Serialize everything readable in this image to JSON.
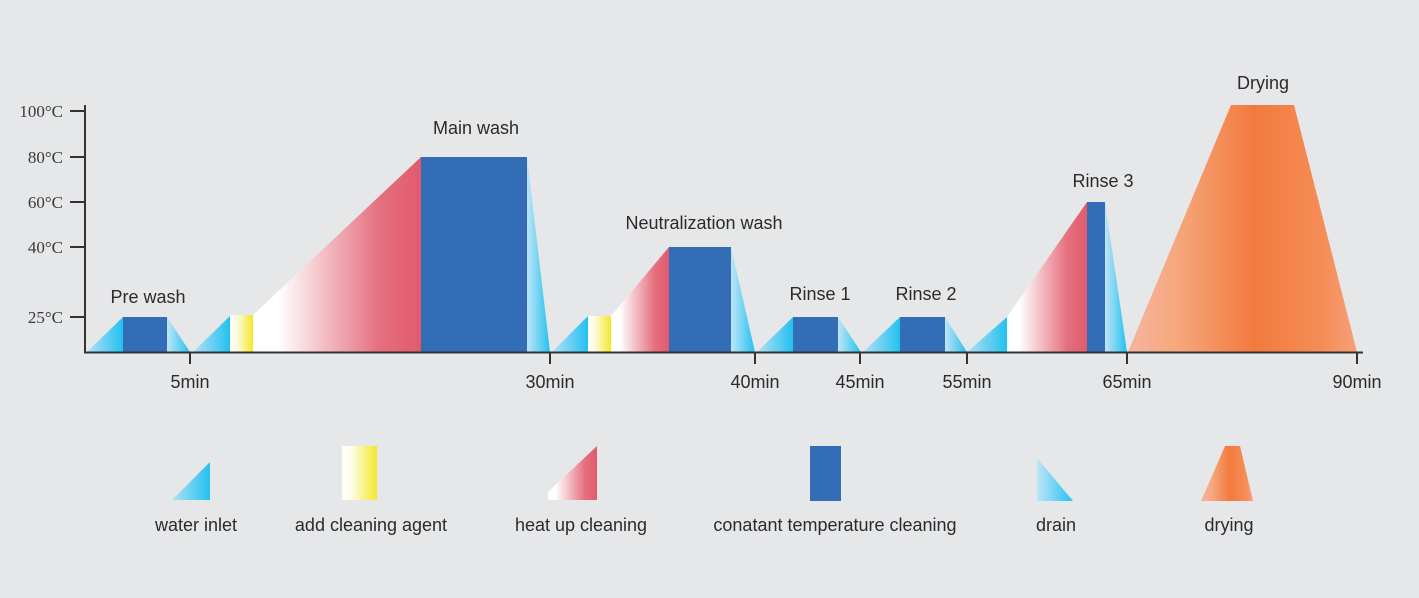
{
  "chart_data": {
    "type": "process-timeline",
    "y_axis": {
      "ticks": [
        "100°C",
        "80°C",
        "60°C",
        "40°C",
        "25°C"
      ]
    },
    "x_axis": {
      "ticks": [
        "5min",
        "30min",
        "40min",
        "45min",
        "55min",
        "65min",
        "90min"
      ]
    },
    "phases": [
      {
        "label": "Pre wash",
        "end": "5min",
        "max_temp": "25°C"
      },
      {
        "label": "Main wash",
        "end": "30min",
        "max_temp": "80°C"
      },
      {
        "label": "Neutralization wash",
        "end": "40min",
        "max_temp": "40°C"
      },
      {
        "label": "Rinse 1",
        "end": "45min",
        "max_temp": "25°C"
      },
      {
        "label": "Rinse 2",
        "end": "55min",
        "max_temp": "25°C"
      },
      {
        "label": "Rinse 3",
        "end": "65min",
        "max_temp": "60°C"
      },
      {
        "label": "Drying",
        "end": "90min",
        "max_temp": "100°C"
      }
    ],
    "legend": [
      {
        "label": "water inlet",
        "icon": "water-inlet",
        "colors": [
          "#a8dcf5",
          "#23c1ef"
        ]
      },
      {
        "label": "add cleaning agent",
        "icon": "cleaning-agent",
        "colors": [
          "#ffffff",
          "#f2e82a"
        ]
      },
      {
        "label": "heat up cleaning",
        "icon": "heat-up",
        "colors": [
          "#ffffff",
          "#e25a6d"
        ]
      },
      {
        "label": "conatant temperature cleaning",
        "icon": "constant-temp",
        "colors": [
          "#336db5"
        ]
      },
      {
        "label": "drain",
        "icon": "drain",
        "colors": [
          "#b4e0f6",
          "#23c1ef"
        ]
      },
      {
        "label": "drying",
        "icon": "drying",
        "colors": [
          "#f7ab86",
          "#f27a3e"
        ]
      }
    ]
  }
}
